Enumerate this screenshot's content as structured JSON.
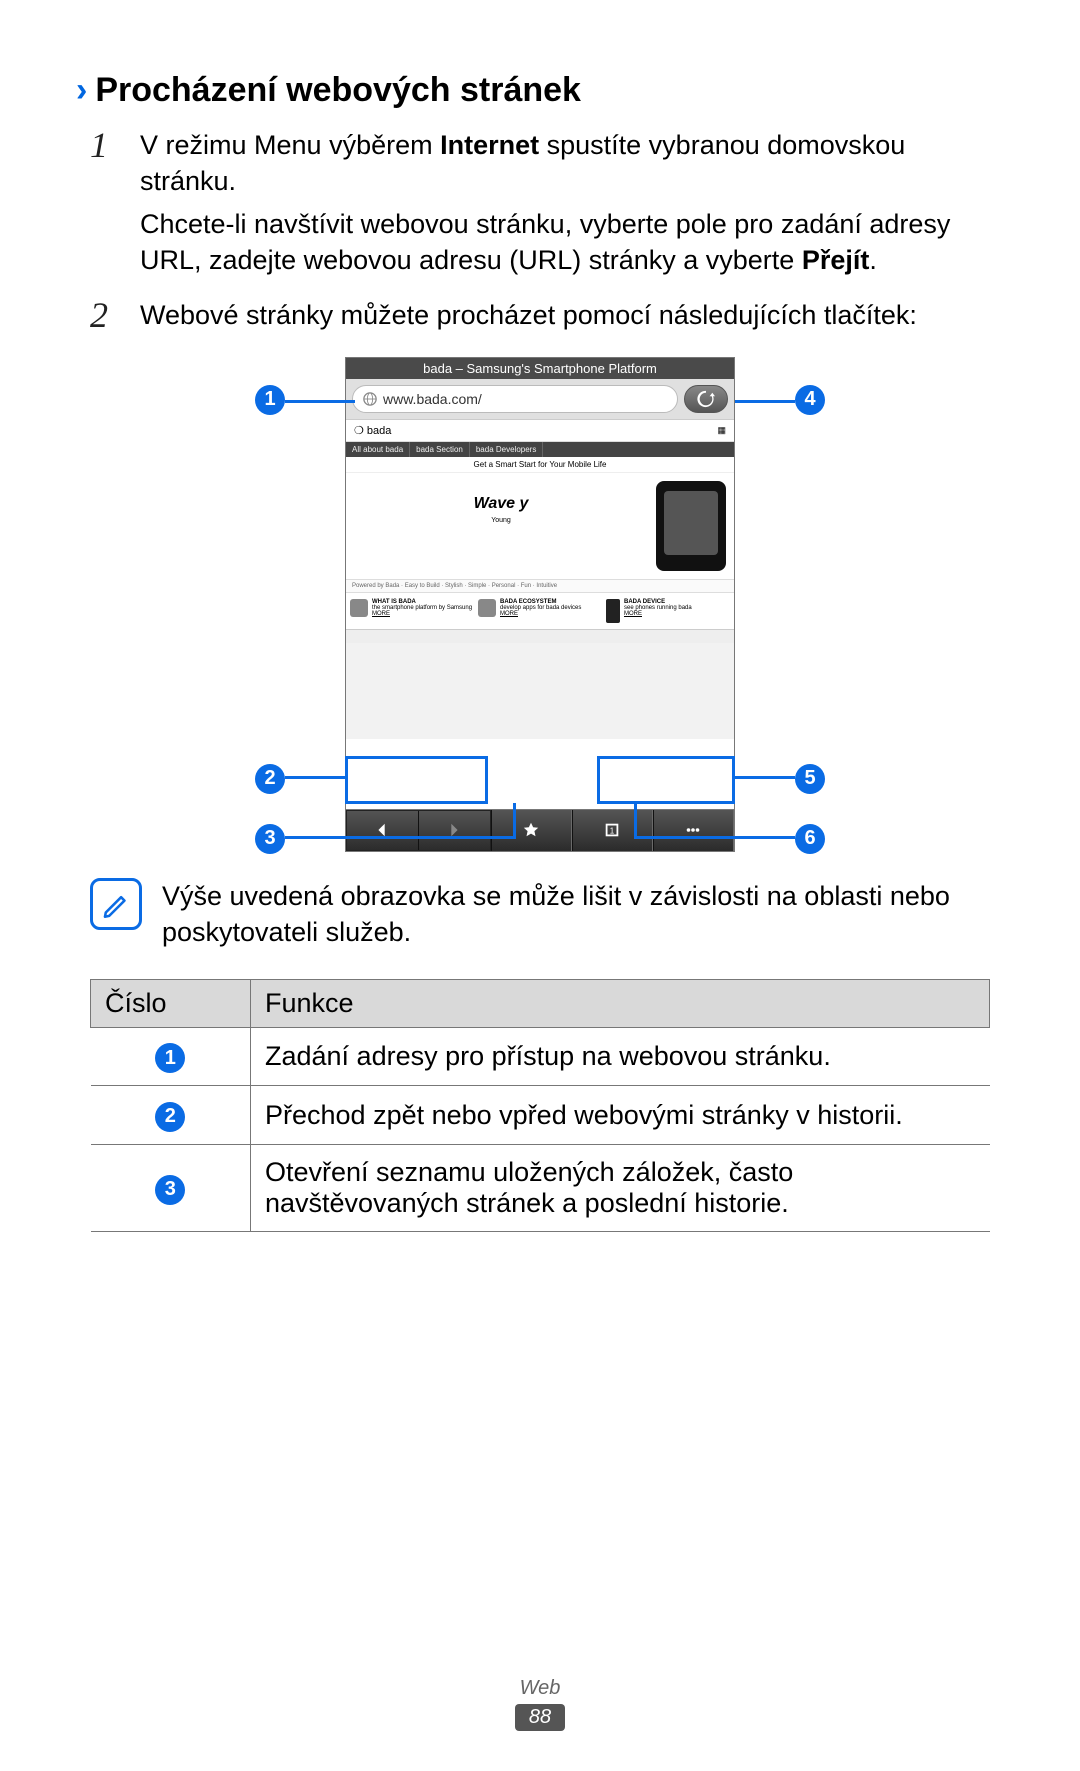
{
  "heading": "Procházení webových stránek",
  "steps": [
    {
      "num": "1",
      "para1_before": "V režimu Menu výběrem ",
      "para1_bold": "Internet",
      "para1_after": " spustíte vybranou domovskou stránku.",
      "para2_before": "Chcete-li navštívit webovou stránku, vyberte pole pro zadání adresy URL, zadejte webovou adresu (URL) stránky a vyberte ",
      "para2_bold": "Přejít",
      "para2_after": "."
    },
    {
      "num": "2",
      "para1_before": "Webové stránky můžete procházet pomocí následujících tlačítek:",
      "para1_bold": "",
      "para1_after": ""
    }
  ],
  "screenshot": {
    "title": "bada – Samsung's Smartphone Platform",
    "url": "www.bada.com/",
    "brand": "bada",
    "wave": "Wave y",
    "hero_tag": "Get a Smart Start for Your Mobile Life"
  },
  "callouts": {
    "c1": "1",
    "c2": "2",
    "c3": "3",
    "c4": "4",
    "c5": "5",
    "c6": "6"
  },
  "note": "Výše uvedená obrazovka se může lišit v závislosti na oblasti nebo poskytovateli služeb.",
  "table": {
    "headers": [
      "Číslo",
      "Funkce"
    ],
    "rows": [
      {
        "n": "1",
        "text": "Zadání adresy pro přístup na webovou stránku."
      },
      {
        "n": "2",
        "text": "Přechod zpět nebo vpřed webovými stránky v historii."
      },
      {
        "n": "3",
        "text": "Otevření seznamu uložených záložek, často navštěvovaných stránek a poslední historie."
      }
    ]
  },
  "footer": {
    "section": "Web",
    "page": "88"
  }
}
